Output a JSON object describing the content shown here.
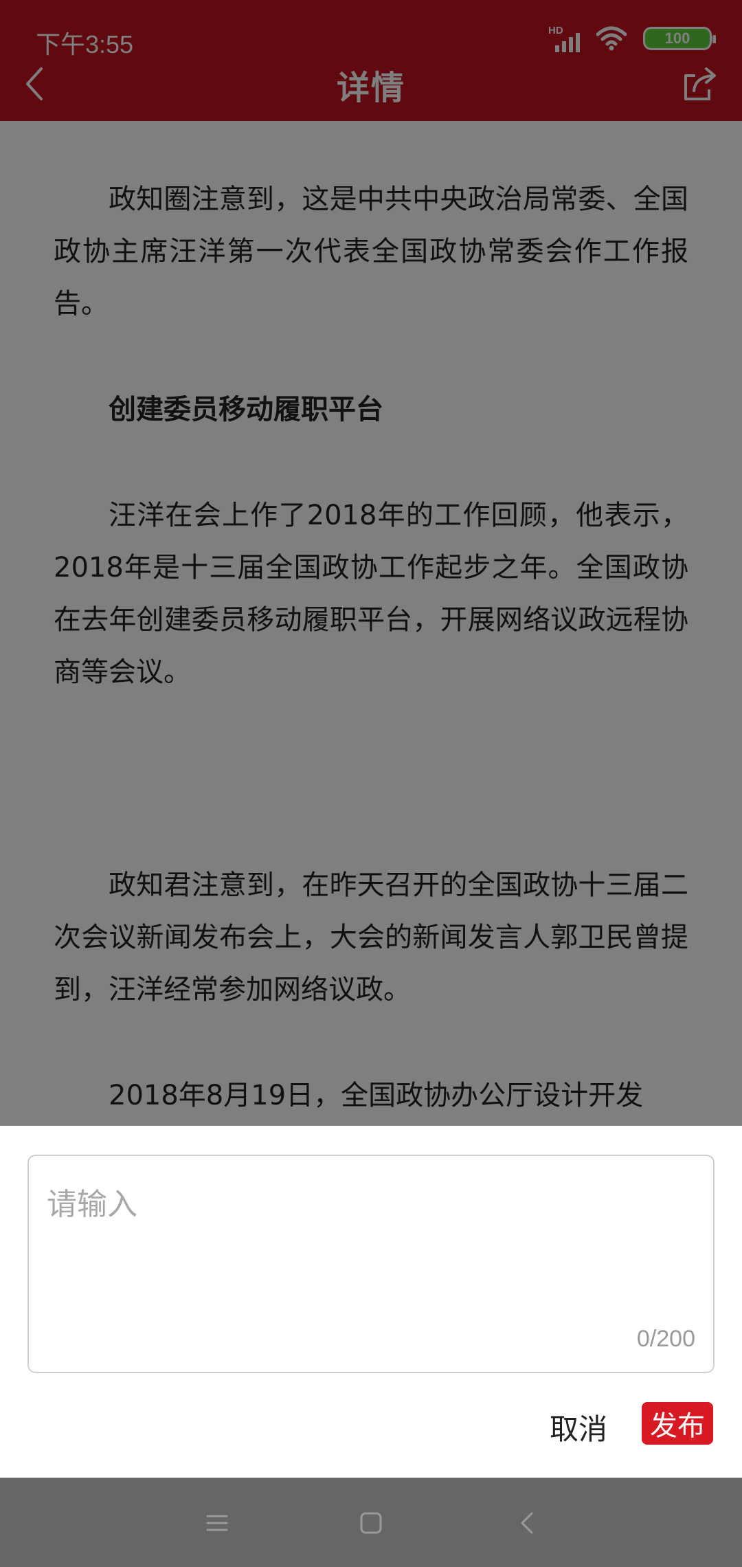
{
  "status_bar": {
    "time": "下午3:55",
    "network_label": "HD",
    "battery": "100"
  },
  "header": {
    "title": "详情",
    "back_icon": "chevron-left-icon",
    "share_icon": "share-icon"
  },
  "article": {
    "paragraphs": [
      "政知圈注意到，这是中共中央政治局常委、全国政协主席汪洋第一次代表全国政协常委会作工作报告。",
      "创建委员移动履职平台",
      "汪洋在会上作了2018年的工作回顾，他表示，2018年是十三届全国政协工作起步之年。全国政协在去年创建委员移动履职平台，开展网络议政远程协商等会议。",
      "政知君注意到，在昨天召开的全国政协十三届二次会议新闻发布会上，大会的新闻发言人郭卫民曾提到，汪洋经常参加网络议政。",
      "2018年8月19日，全国政协办公厅设计开发"
    ]
  },
  "comment_sheet": {
    "placeholder": "请输入",
    "counter": "0/200",
    "cancel_label": "取消",
    "publish_label": "发布"
  },
  "colors": {
    "brand_red": "#c0121c",
    "publish_red": "#d71921"
  }
}
